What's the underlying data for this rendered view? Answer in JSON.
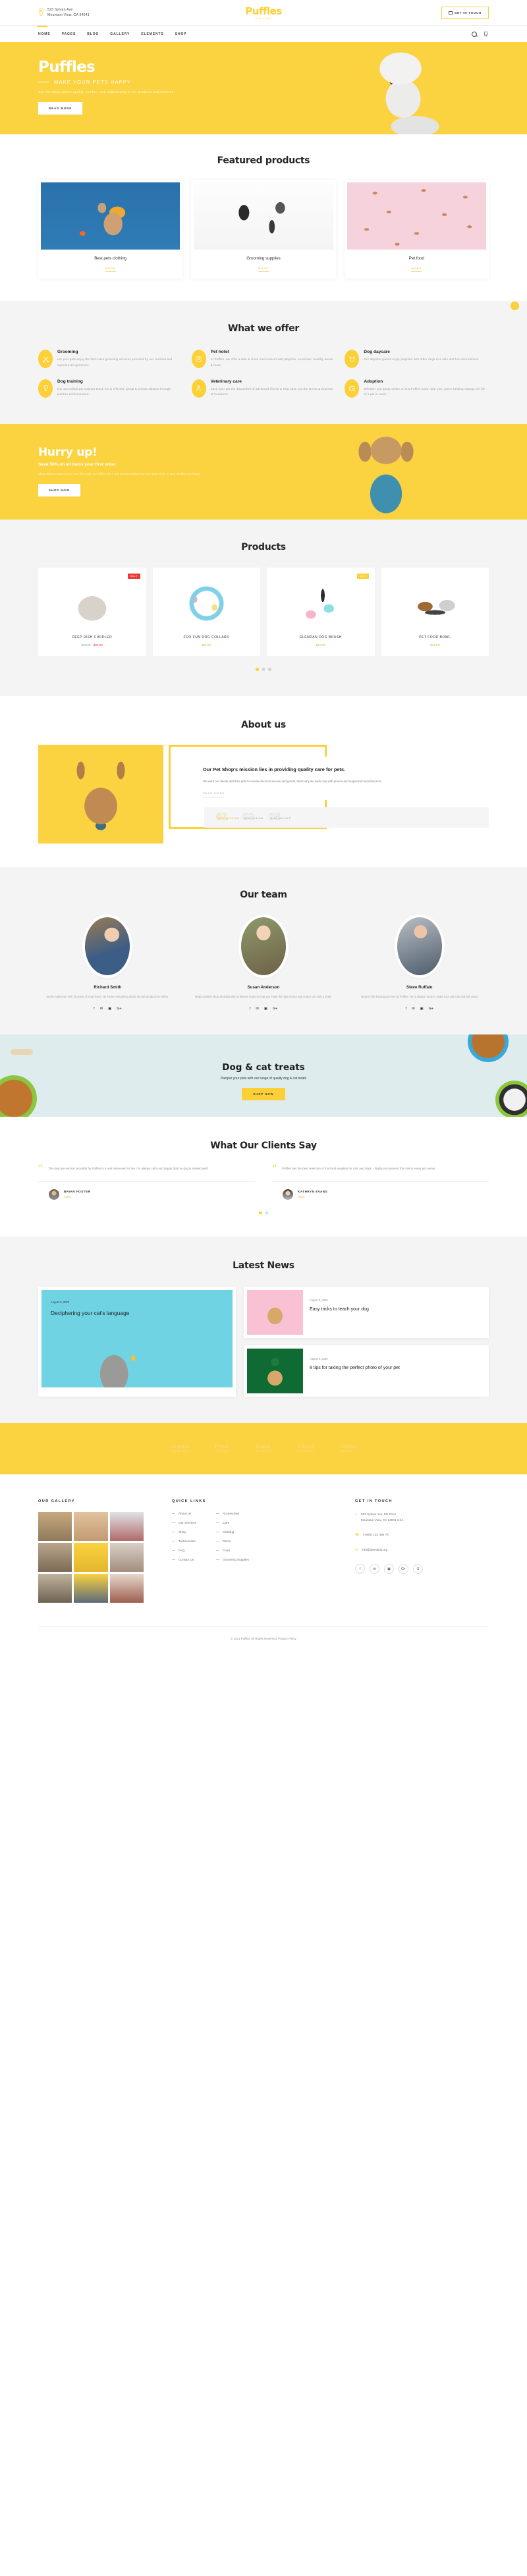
{
  "brand": {
    "name": "Puffles",
    "tagline": "Pet shop",
    "accent": "#fcd036",
    "dark": "#2b2b2b"
  },
  "topbar": {
    "address_line1": "523 Sylvan Ave",
    "address_line2": "Mountain View, CA 94041",
    "cta_label": "GET IN TOUCH",
    "pin_icon": "location-pin-icon",
    "envelope_icon": "envelope-icon"
  },
  "nav": {
    "items": [
      "HOME",
      "PAGES",
      "BLOG",
      "GALLERY",
      "ELEMENTS",
      "SHOP"
    ],
    "active_index": 0,
    "search_icon": "search-icon",
    "cart_icon": "cart-icon"
  },
  "hero": {
    "title": "Puffles",
    "subtitle": "MAKE YOUR PETS HAPPY",
    "paragraph": "Our Pet Shop values quality, comfort, and individuality of our products and services.",
    "button": "READ MORE"
  },
  "featured": {
    "title": "Featured products",
    "more_label": "MORE",
    "items": [
      {
        "name": "Best pets clothing"
      },
      {
        "name": "Grooming supplies"
      },
      {
        "name": "Pet food"
      }
    ]
  },
  "scroll_top": {
    "icon": "arrow-up-icon",
    "glyph": "↑"
  },
  "offer": {
    "title": "What we offer",
    "items": [
      {
        "icon": "scissors-icon",
        "glyph": "✂",
        "title": "Grooming",
        "text": "Let your pets enjoy the first-class grooming services provided by our certified and experienced groomers."
      },
      {
        "icon": "pet-house-icon",
        "glyph": "⌂",
        "title": "Pet hotel",
        "text": "At Puffles, we offer a safe & clean environment with playtime, exercises, healthy meals & more."
      },
      {
        "icon": "dog-face-icon",
        "glyph": "◔",
        "title": "Dog daycare",
        "text": "Our daytime guests enjoy playtime with other dogs in a safe and fun environment."
      },
      {
        "icon": "trophy-icon",
        "glyph": "Ἴ6",
        "title": "Dog training",
        "text": "Our accredited pet trainers teach fun & effective group & private classes through positive reinforcement."
      },
      {
        "icon": "vet-icon",
        "glyph": "⚕",
        "title": "Veterinary care",
        "text": "Save your pet the discomfort of advanced illness & help save you the stress & expense of treatment."
      },
      {
        "icon": "pet-carrier-icon",
        "glyph": "▤",
        "title": "Adoption",
        "text": "Whether you adopt online or at a Puffles store near you, you're helping change the life of a pet in need."
      }
    ]
  },
  "hurry": {
    "title": "Hurry up!",
    "subtitle": "Save 50% on all items your first order",
    "paragraph": "Shop today to save big on your first order at Puffles Store and get everything that your dog needs to stay healthy and happy.",
    "button": "SHOP NOW"
  },
  "products": {
    "title": "Products",
    "items": [
      {
        "badge": "SALE",
        "badge_type": "sale",
        "name": "DEEP DISH CUDDLER",
        "old_price": "$30.00",
        "price": "$23.00"
      },
      {
        "badge": "",
        "badge_type": "",
        "name": "ZOO FUN DOG COLLARS",
        "old_price": "",
        "price": "$11.00"
      },
      {
        "badge": "NEW",
        "badge_type": "new",
        "name": "GLENDAN DOG BRUSH",
        "old_price": "",
        "price": "$17.00"
      },
      {
        "badge": "",
        "badge_type": "",
        "name": "PET FOOD BOWL",
        "old_price": "",
        "price": "$12.00"
      }
    ],
    "dots": 3,
    "active_dot": 0
  },
  "about": {
    "title": "About us",
    "heading": "Our Pet Shop's mission lies in providing quality care for pets.",
    "paragraph": "We want our clients and their pets to receive the best service and goods, that's why we work only with proven and respected manufacturers.",
    "more_label": "READ MORE",
    "tabs": [
      {
        "num": "01",
        "label": "OUR MISSION",
        "active": true
      },
      {
        "num": "02",
        "label": "OUR VISION",
        "active": false
      },
      {
        "num": "03",
        "label": "OUR VALUES",
        "active": false
      }
    ]
  },
  "team": {
    "title": "Our team",
    "members": [
      {
        "name": "Richard Smith",
        "bio": "Senior salesman with 15 years of experience. He knows everything about the pet products he offers."
      },
      {
        "name": "Susan Anderson",
        "bio": "Mega positive shop assistant who is always ready to help you make the right choice and charm you with a smile."
      },
      {
        "name": "Steve Ruffalo",
        "bio": "Steve is the leading groomer at Puffles. He is always ready to make your pet look and feel good."
      }
    ],
    "social_icons": [
      "facebook-icon",
      "twitter-icon",
      "instagram-icon",
      "google-plus-icon"
    ],
    "social_glyphs": [
      "f",
      "✉",
      "▣",
      "G+"
    ]
  },
  "treats": {
    "title": "Dog & cat treats",
    "subtitle": "Pamper your pets with our range of quality dog & cat treats",
    "button": "SHOP NOW"
  },
  "testimonials": {
    "title": "What Our Clients Say",
    "items": [
      {
        "quote": "The daycare service provided by Puffles is a real timesaver for me. I'm always calm and happy that my dog is treated well.",
        "name": "BRIAN FOSTER",
        "role": "Client"
      },
      {
        "quote": "Puffles has the best selection of food and supplies for cats and dogs. I highly recommend this site to every pet owner.",
        "name": "KATHRYN EVANS",
        "role": "Client"
      }
    ],
    "dots": 2,
    "active_dot": 0
  },
  "news": {
    "title": "Latest News",
    "featured": {
      "date": "August 9, 2020",
      "title": "Deciphering your cat's language"
    },
    "side": [
      {
        "date": "August 9, 2020",
        "title": "Easy tricks to teach your dog"
      },
      {
        "date": "August 9, 2020",
        "title": "8 tips for taking the perfect photo of your pet"
      }
    ]
  },
  "brands": [
    {
      "main": "Organic",
      "sub": "NATURAL"
    },
    {
      "main": "Fresh",
      "sub": "VEGAN"
    },
    {
      "main": "Angus",
      "sub": "PREMIUM"
    },
    {
      "main": "Choice",
      "sub": "QUALITY"
    },
    {
      "main": "Verona",
      "sub": "SELECT"
    }
  ],
  "footer": {
    "gallery_title": "OUR GALLERY",
    "quick_title": "QUICK LINKS",
    "contact_title": "GET IN TOUCH",
    "quick_links_col1": [
      "About Us",
      "Our Services",
      "Shop",
      "Testimonials",
      "FAQ",
      "Contact Us"
    ],
    "quick_links_col2": [
      "Accessories",
      "Care",
      "Clothing",
      "Decor",
      "Food",
      "Grooming Supplies"
    ],
    "contact": {
      "address_line1": "523 Sylvan Ave, 5th Floor",
      "address_line2": "Mountain View, CA 94041 USA",
      "phone": "(+844) 123 456 78",
      "email": "info@demolink.org",
      "pin_icon": "location-pin-icon",
      "phone_icon": "phone-icon",
      "mail_icon": "mail-icon"
    },
    "socials": [
      "facebook-icon",
      "twitter-icon",
      "instagram-icon",
      "google-plus-icon",
      "skype-icon"
    ],
    "social_glyphs": [
      "f",
      "✉",
      "▣",
      "G+",
      "S"
    ],
    "copyright": "© 2021 Puffles. All Rights Reserved.",
    "privacy": "Privacy Policy"
  }
}
